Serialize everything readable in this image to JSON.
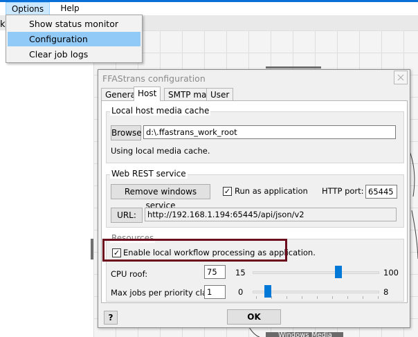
{
  "background_app": {
    "menu": {
      "options": "Options",
      "help": "Help"
    },
    "stray_char": "k",
    "canvas_node_label": "Windows Media"
  },
  "options_menu": {
    "items": [
      "Show status monitor",
      "Configuration",
      "Clear job logs"
    ],
    "selected": "Configuration"
  },
  "dialog": {
    "title": "FFAStrans configuration",
    "tabs": [
      "General",
      "Host",
      "SMTP mail",
      "User"
    ],
    "active_tab": "Host",
    "local_cache": {
      "title": "Local host media cache",
      "browse_label": "Browse",
      "path_value": "d:\\.ffastrans_work_root",
      "status_text": "Using local media cache."
    },
    "rest": {
      "title": "Web REST service",
      "remove_service_label": "Remove windows service",
      "run_as_app_label": "Run as application",
      "run_as_app_checked": true,
      "http_port_label": "HTTP port:",
      "http_port_value": "65445",
      "url_button_label": "URL:",
      "url_value": "http://192.168.1.194:65445/api/json/v2"
    },
    "resources": {
      "title": "Resources",
      "enable_local_label": "Enable local workflow processing as application.",
      "enable_local_checked": true,
      "cpu_roof_label": "CPU roof:",
      "cpu_roof_value": "75",
      "cpu_min": "15",
      "cpu_max": "100",
      "max_jobs_label": "Max jobs per priority class:",
      "max_jobs_value": "1",
      "jobs_min": "0",
      "jobs_max": "8"
    },
    "help_label": "?",
    "ok_label": "OK"
  },
  "colors": {
    "accent": "#0078d7",
    "menu_selected": "#91c9f7",
    "highlight_box": "#6b0d1a"
  }
}
